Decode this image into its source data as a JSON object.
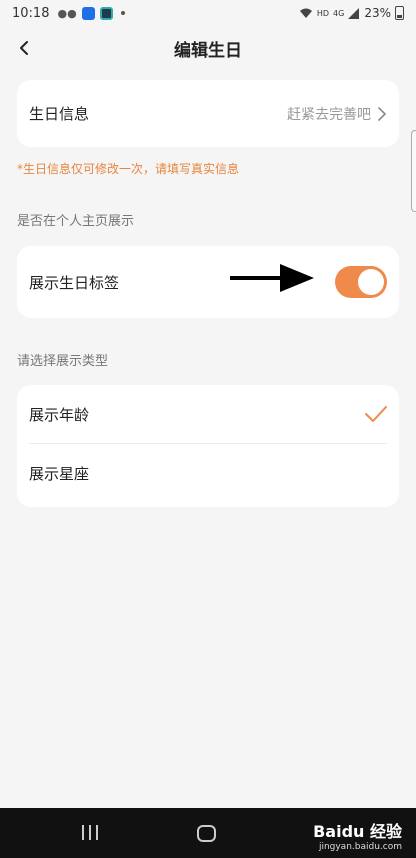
{
  "status_bar": {
    "time": "10:18",
    "network_small": "HD",
    "signal_small": "4G",
    "battery": "23%"
  },
  "header": {
    "title": "编辑生日"
  },
  "birthday_info": {
    "label": "生日信息",
    "value": "赶紧去完善吧"
  },
  "warning": "*生日信息仅可修改一次，请填写真实信息",
  "display_section": {
    "label": "是否在个人主页展示",
    "toggle_label": "展示生日标签",
    "toggle_on": true
  },
  "type_section": {
    "label": "请选择展示类型",
    "options": [
      {
        "label": "展示年龄",
        "selected": true
      },
      {
        "label": "展示星座",
        "selected": false
      }
    ]
  },
  "watermark": {
    "brand": "Baidu 经验",
    "url": "jingyan.baidu.com"
  },
  "colors": {
    "accent": "#f08a4b",
    "warning": "#e8853e",
    "background": "#f5f5f5"
  }
}
